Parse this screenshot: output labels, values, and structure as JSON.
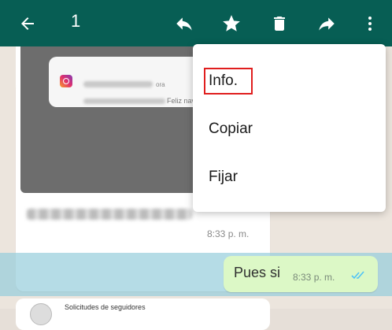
{
  "toolbar": {
    "selected_count": "1",
    "icons": [
      "back-arrow-icon",
      "reply-icon",
      "star-icon",
      "delete-icon",
      "forward-icon",
      "more-vert-icon"
    ]
  },
  "chat": {
    "incoming": {
      "notification_card": {
        "app_icon": "instagram-icon",
        "suffix_top": "ora",
        "suffix": "Feliz nav.."
      },
      "time": "8:33 p. m."
    },
    "outgoing": {
      "text": "Pues si",
      "time": "8:33 p. m.",
      "status_icon": "double-check-icon",
      "status_color": "#4fc3f7"
    },
    "next": {
      "text": "Solicitudes de seguidores"
    }
  },
  "menu": {
    "items": [
      {
        "label": "Info."
      },
      {
        "label": "Copiar"
      },
      {
        "label": "Fijar"
      }
    ]
  },
  "colors": {
    "header": "#075e54",
    "outgoing_bubble": "#dcf8c6",
    "selection": "#96cddc",
    "highlight_box": "#e01e1e"
  }
}
